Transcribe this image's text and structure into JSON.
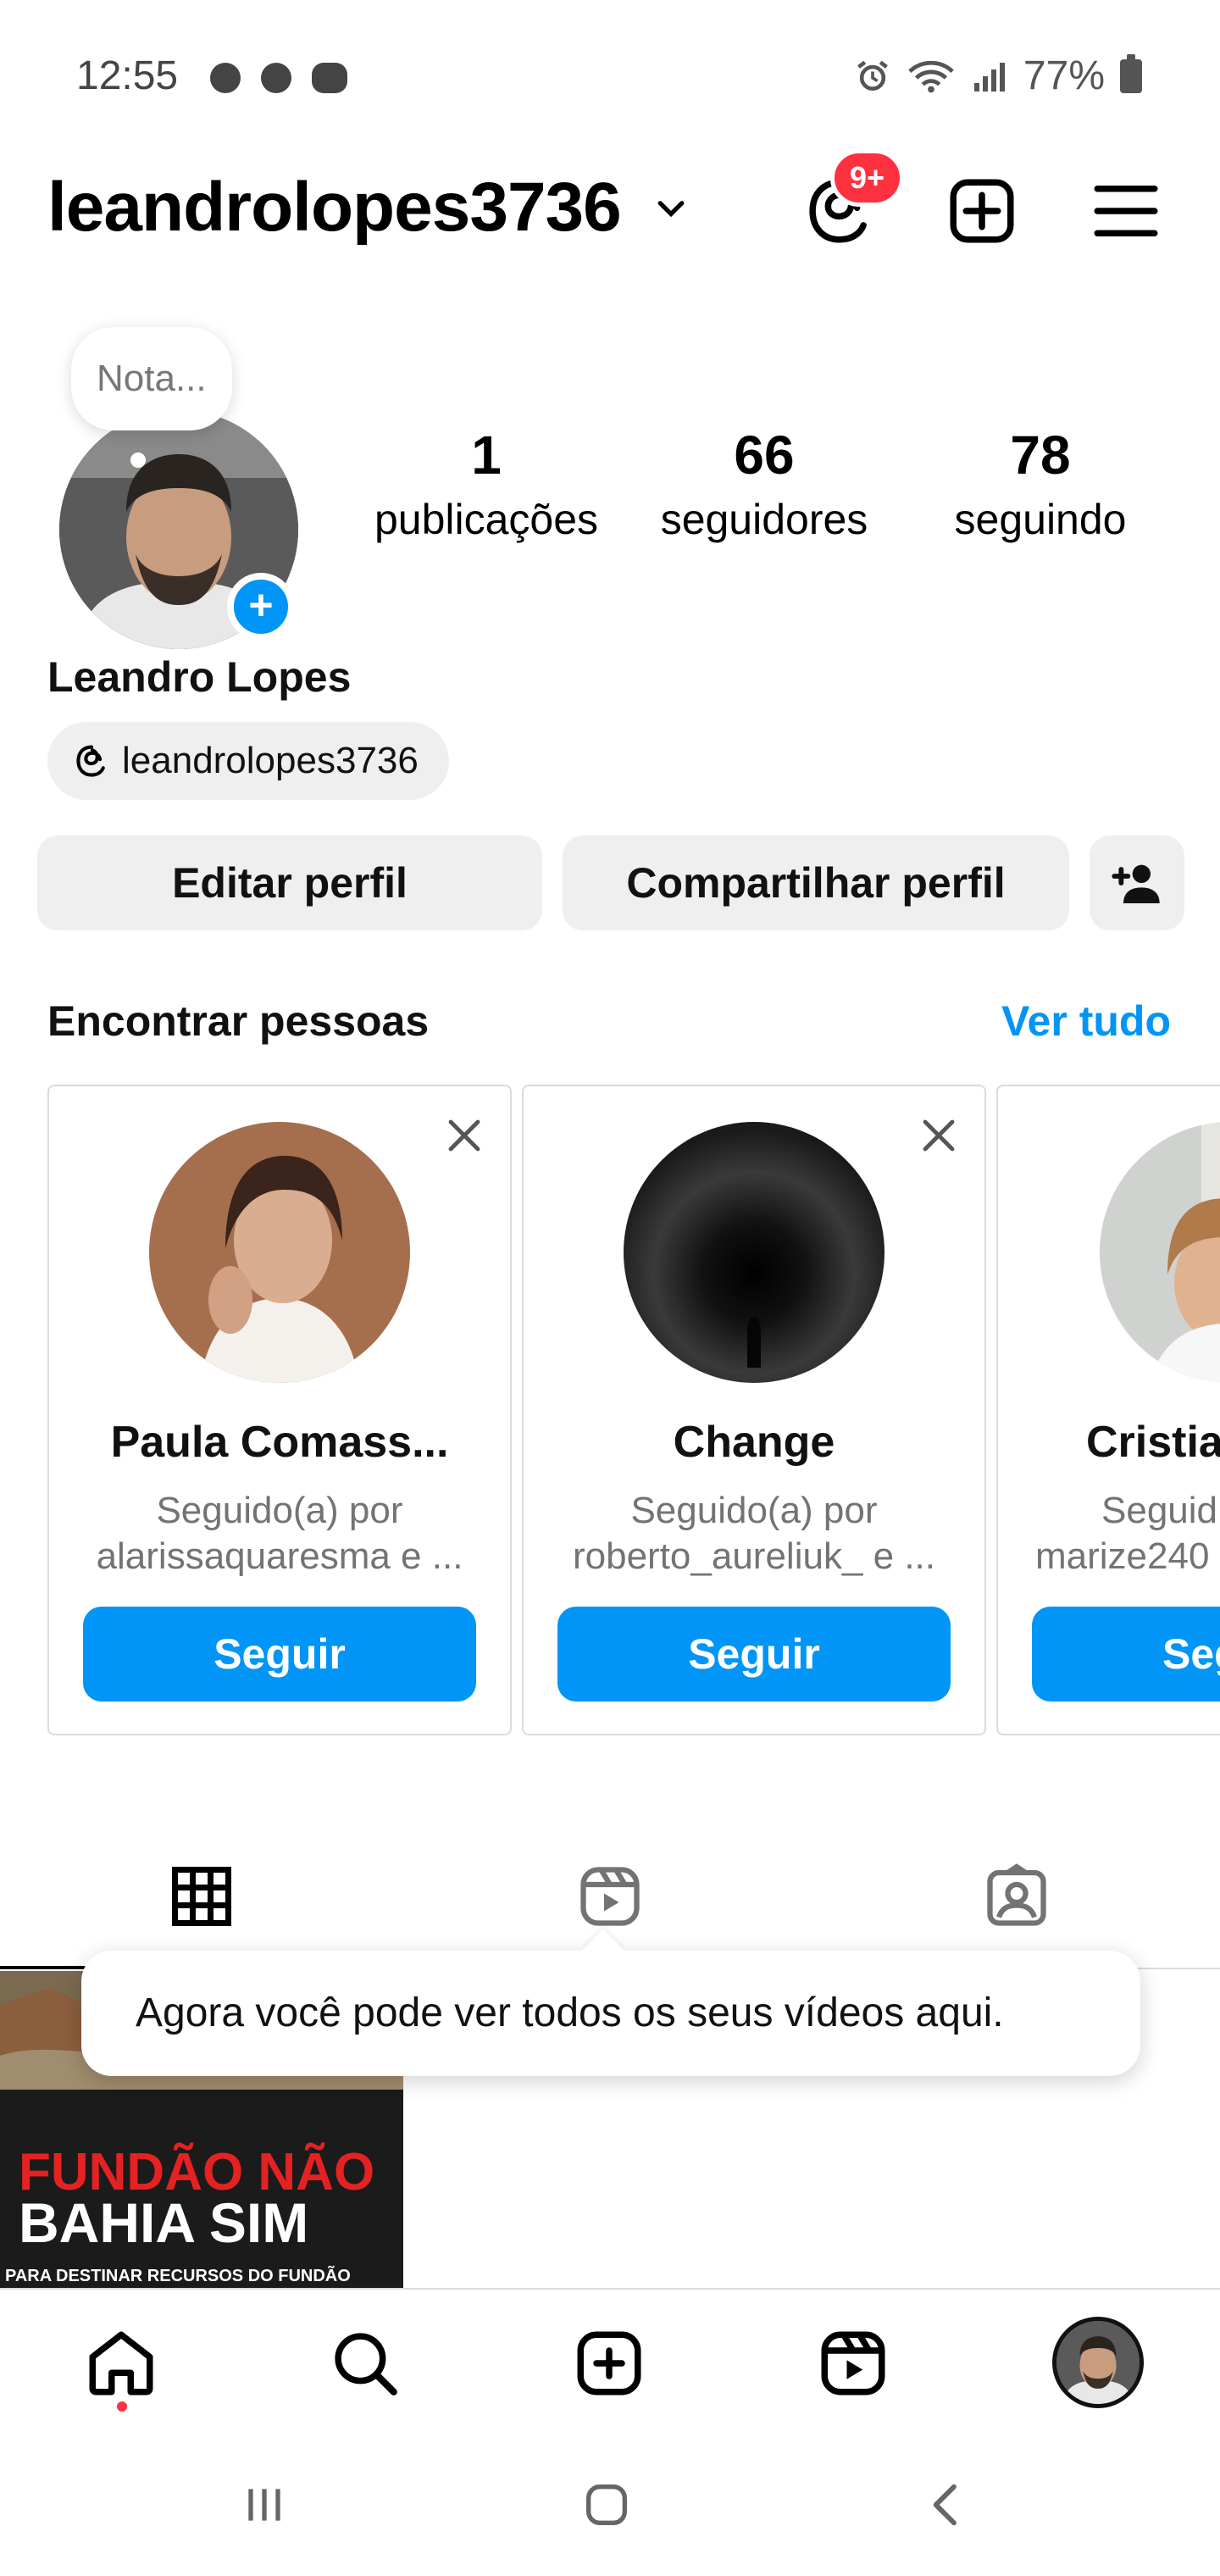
{
  "status_bar": {
    "time": "12:55",
    "battery": "77%",
    "icons": [
      "sync-icon",
      "vpn-icon",
      "wear-icon",
      "alarm-icon",
      "wifi-icon",
      "signal-icon",
      "battery-icon"
    ]
  },
  "header": {
    "username": "leandrolopes3736",
    "notification_badge": "9+",
    "icons": [
      "threads-icon",
      "new-post-icon",
      "menu-icon"
    ]
  },
  "profile": {
    "note_placeholder": "Nota...",
    "display_name": "Leandro Lopes",
    "threads_handle": "leandrolopes3736",
    "stats": [
      {
        "value": "1",
        "label": "publicações"
      },
      {
        "value": "66",
        "label": "seguidores"
      },
      {
        "value": "78",
        "label": "seguindo"
      }
    ],
    "edit_button": "Editar perfil",
    "share_button": "Compartilhar perfil"
  },
  "suggestions": {
    "title": "Encontrar pessoas",
    "see_all": "Ver tudo",
    "cards": [
      {
        "name": "Paula Comass...",
        "sub1": "Seguido(a) por",
        "sub2": "alarissaquaresma e ...",
        "button": "Seguir"
      },
      {
        "name": "Change",
        "sub1": "Seguido(a) por",
        "sub2": "roberto_aureliuk_ e ...",
        "button": "Seguir"
      },
      {
        "name": "Cristia",
        "sub1": "Seguid",
        "sub2": "marize240",
        "button": "Seg"
      }
    ]
  },
  "tabs": [
    "grid-tab",
    "reels-tab",
    "tagged-tab"
  ],
  "tooltip": "Agora você pode ver todos os seus vídeos aqui.",
  "post": {
    "line1": "FUNDÃO NÃO",
    "line2": "BAHIA SIM",
    "line3": "PARA DESTINAR RECURSOS DO FUNDÃO"
  },
  "colors": {
    "accent": "#0095f6",
    "badge": "#ff3040",
    "button_gray": "#efefef"
  }
}
